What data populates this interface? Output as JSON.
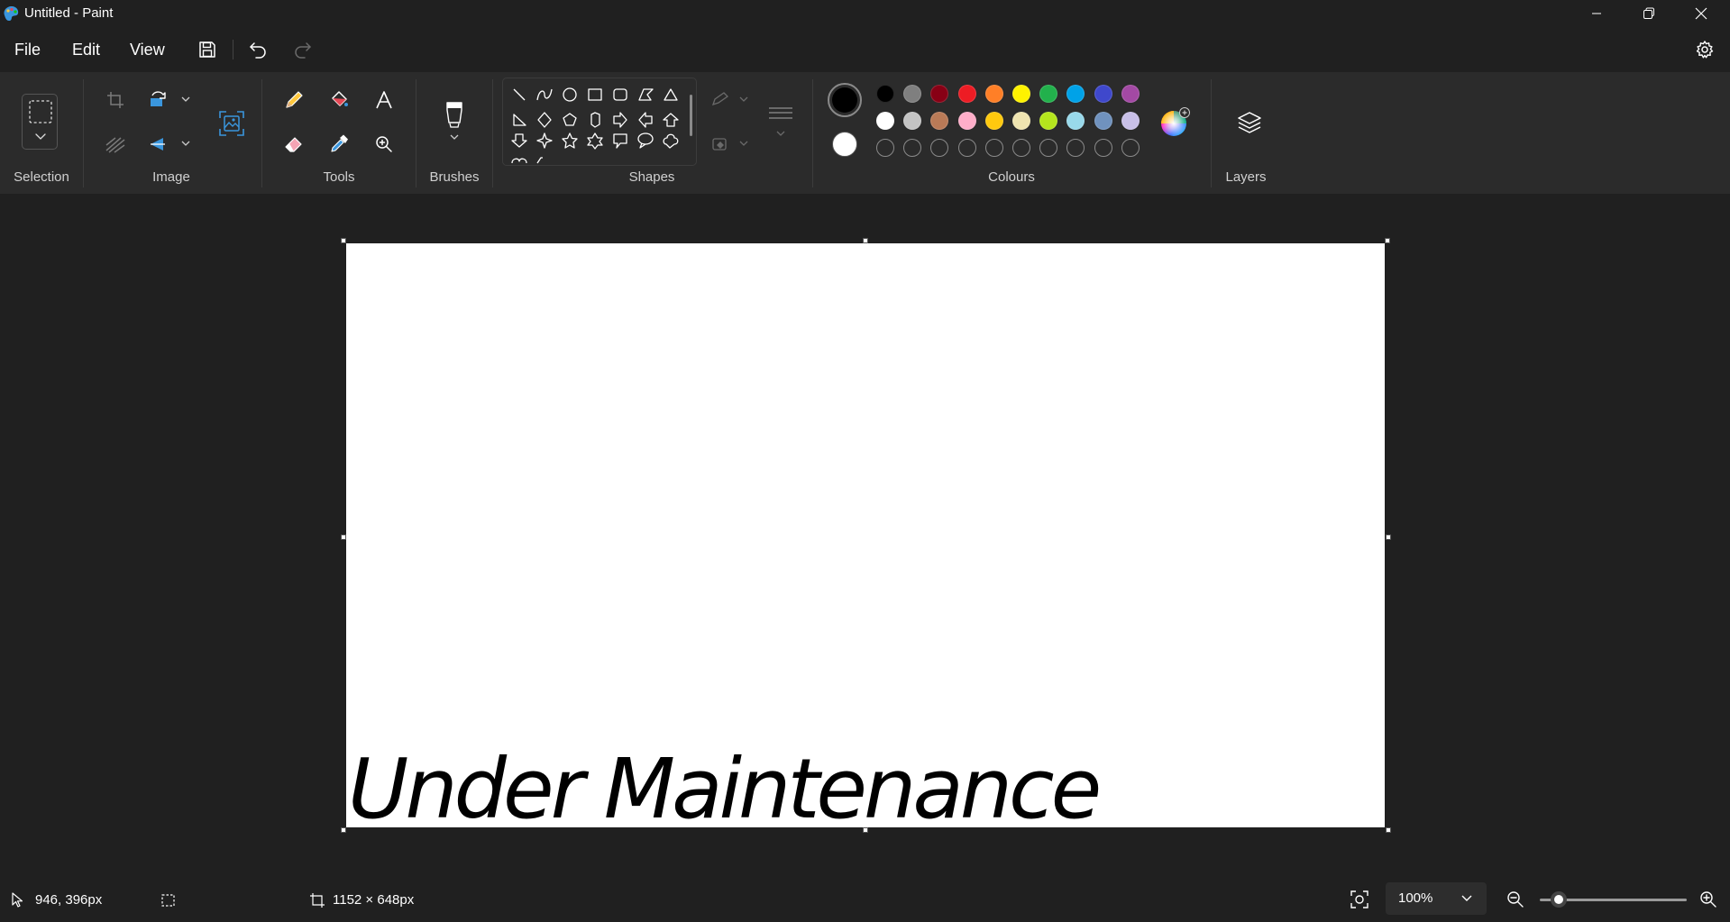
{
  "window": {
    "title": "Untitled - Paint"
  },
  "menu": {
    "file": "File",
    "edit": "Edit",
    "view": "View"
  },
  "ribbon": {
    "groups": {
      "selection": "Selection",
      "image": "Image",
      "tools": "Tools",
      "brushes": "Brushes",
      "shapes": "Shapes",
      "colours": "Colours",
      "layers": "Layers"
    }
  },
  "colours": {
    "primary": "#000000",
    "secondary": "#ffffff",
    "row1": [
      "#000000",
      "#7f7f7f",
      "#880015",
      "#ed1c24",
      "#ff7f27",
      "#fff200",
      "#22b14c",
      "#00a2e8",
      "#3f48cc",
      "#a349a4"
    ],
    "row2": [
      "#ffffff",
      "#c3c3c3",
      "#b97a57",
      "#ffaec9",
      "#ffc90e",
      "#efe4b0",
      "#b5e61d",
      "#99d9ea",
      "#7092be",
      "#c8bfe7"
    ],
    "custom_slots": 10
  },
  "canvas": {
    "text": "Under Maintenance"
  },
  "status": {
    "cursor_position": "946, 396px",
    "canvas_size": "1152 × 648px",
    "zoom": "100%"
  }
}
